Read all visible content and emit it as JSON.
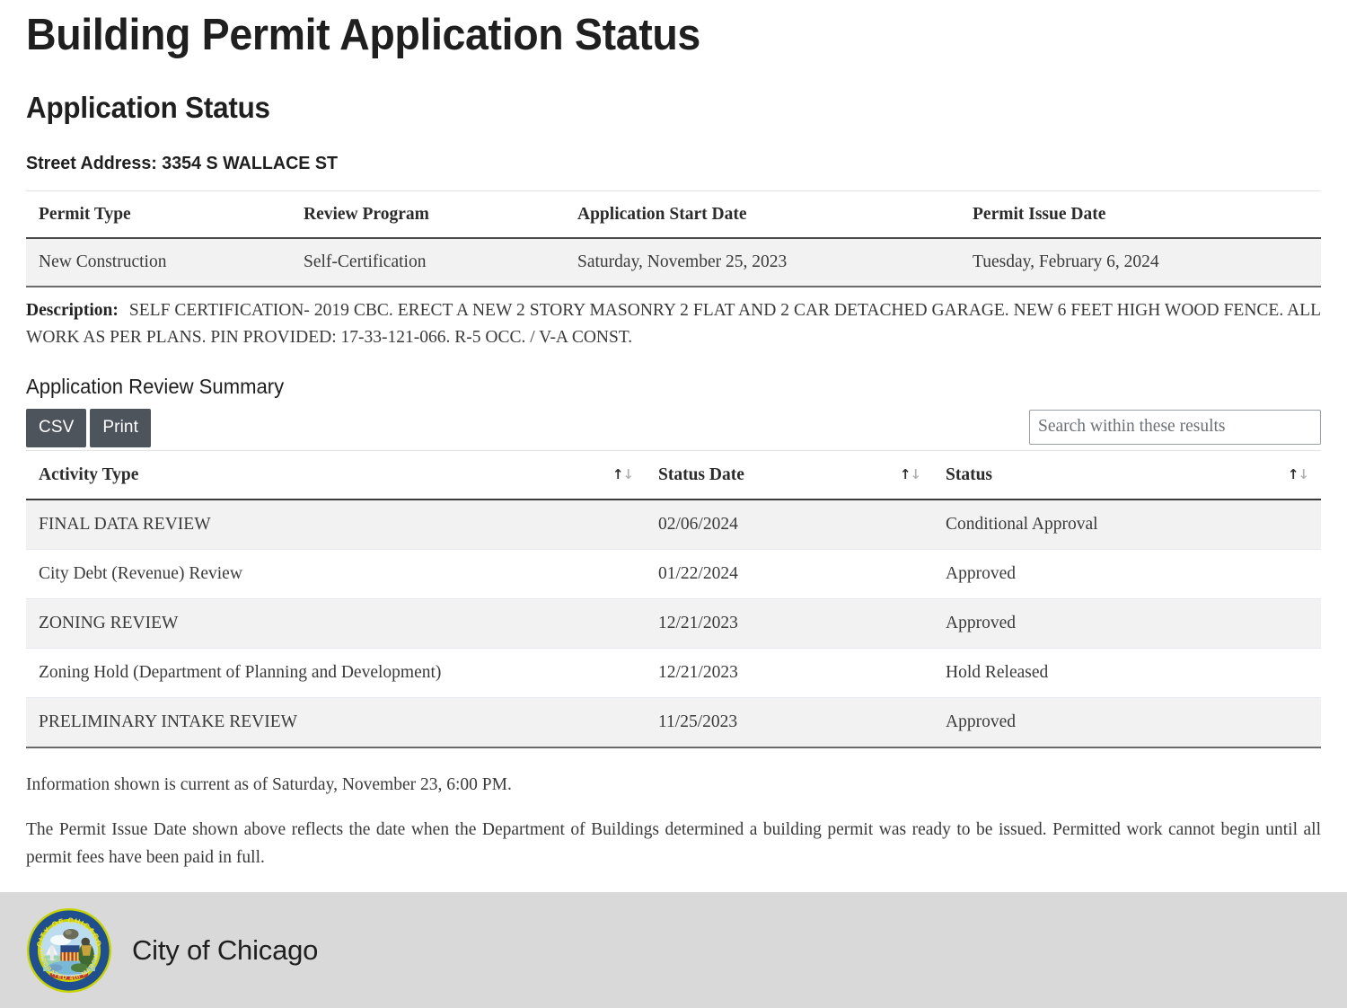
{
  "page": {
    "title": "Building Permit Application Status",
    "section_heading": "Application Status",
    "street_address_line": "Street Address: 3354 S WALLACE ST"
  },
  "permit_table": {
    "headers": [
      "Permit Type",
      "Review Program",
      "Application Start Date",
      "Permit Issue Date"
    ],
    "row": {
      "permit_type": "New Construction",
      "review_program": "Self-Certification",
      "application_start_date": "Saturday, November 25, 2023",
      "permit_issue_date": "Tuesday, February 6, 2024"
    }
  },
  "description": {
    "label": "Description:",
    "text": "SELF CERTIFICATION- 2019 CBC. ERECT A NEW 2 STORY MASONRY 2 FLAT AND 2 CAR DETACHED GARAGE. NEW 6 FEET HIGH WOOD FENCE. ALL WORK AS PER PLANS. PIN PROVIDED: 17-33-121-066. R-5 OCC. / V-A CONST."
  },
  "review_summary": {
    "heading": "Application Review Summary",
    "buttons": {
      "csv": "CSV",
      "print": "Print"
    },
    "search": {
      "placeholder": "Search within these results",
      "value": ""
    },
    "sort_indicator": {
      "up": "↑",
      "down": "↓"
    },
    "headers": [
      "Activity Type",
      "Status Date",
      "Status"
    ],
    "rows": [
      {
        "activity_type": "FINAL DATA REVIEW",
        "status_date": "02/06/2024",
        "status": "Conditional Approval"
      },
      {
        "activity_type": "City Debt (Revenue) Review",
        "status_date": "01/22/2024",
        "status": "Approved"
      },
      {
        "activity_type": "ZONING REVIEW",
        "status_date": "12/21/2023",
        "status": "Approved"
      },
      {
        "activity_type": "Zoning Hold (Department of Planning and Development)",
        "status_date": "12/21/2023",
        "status": "Hold Released"
      },
      {
        "activity_type": "PRELIMINARY INTAKE REVIEW",
        "status_date": "11/25/2023",
        "status": "Approved"
      }
    ]
  },
  "notes": {
    "currency": "Information shown is current as of Saturday, November 23, 6:00 PM.",
    "disclaimer": "The Permit Issue Date shown above reflects the date when the Department of Buildings determined a building permit was ready to be issued. Permitted work cannot begin until all permit fees have been paid in full."
  },
  "footer": {
    "brand": "City of Chicago",
    "seal_outer_text_top": "CITY OF CHICAGO",
    "seal_outer_text_bottom": "INCORPORATED 4th MARCH 1837"
  },
  "colors": {
    "button_bg": "#4d545c",
    "footer_bg": "#d9d9d9",
    "row_stripe": "#f2f2f2",
    "seal_ring": "#1f4f8f",
    "seal_ring_outline": "#c8d400"
  }
}
